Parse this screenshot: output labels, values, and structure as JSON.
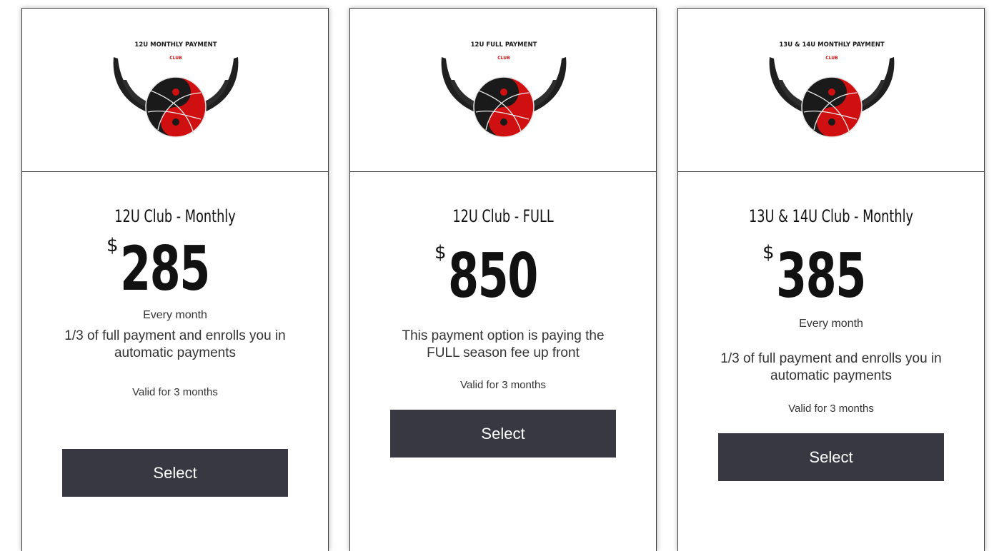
{
  "colors": {
    "button_bg": "#383843",
    "logo_red": "#d01010",
    "logo_dark": "#1f1f1f"
  },
  "plans": [
    {
      "logo_title": "12U MONTHLY PAYMENT",
      "logo_sub": "CLUB",
      "name": "12U Club - Monthly",
      "currency": "$",
      "price": "285",
      "frequency": "Every month",
      "description": "1/3 of full payment and enrolls you in automatic payments",
      "valid": "Valid for 3 months",
      "button": "Select"
    },
    {
      "logo_title": "12U FULL PAYMENT",
      "logo_sub": "CLUB",
      "name": "12U Club - FULL",
      "currency": "$",
      "price": "850",
      "frequency": "",
      "description": "This payment option is paying the FULL season fee up front",
      "valid": "Valid for 3 months",
      "button": "Select"
    },
    {
      "logo_title": "13U & 14U MONTHLY PAYMENT",
      "logo_sub": "CLUB",
      "name": "13U & 14U Club - Monthly",
      "currency": "$",
      "price": "385",
      "frequency": "Every month",
      "description": "1/3 of full payment and enrolls you in automatic payments",
      "valid": "Valid for 3 months",
      "button": "Select"
    }
  ]
}
